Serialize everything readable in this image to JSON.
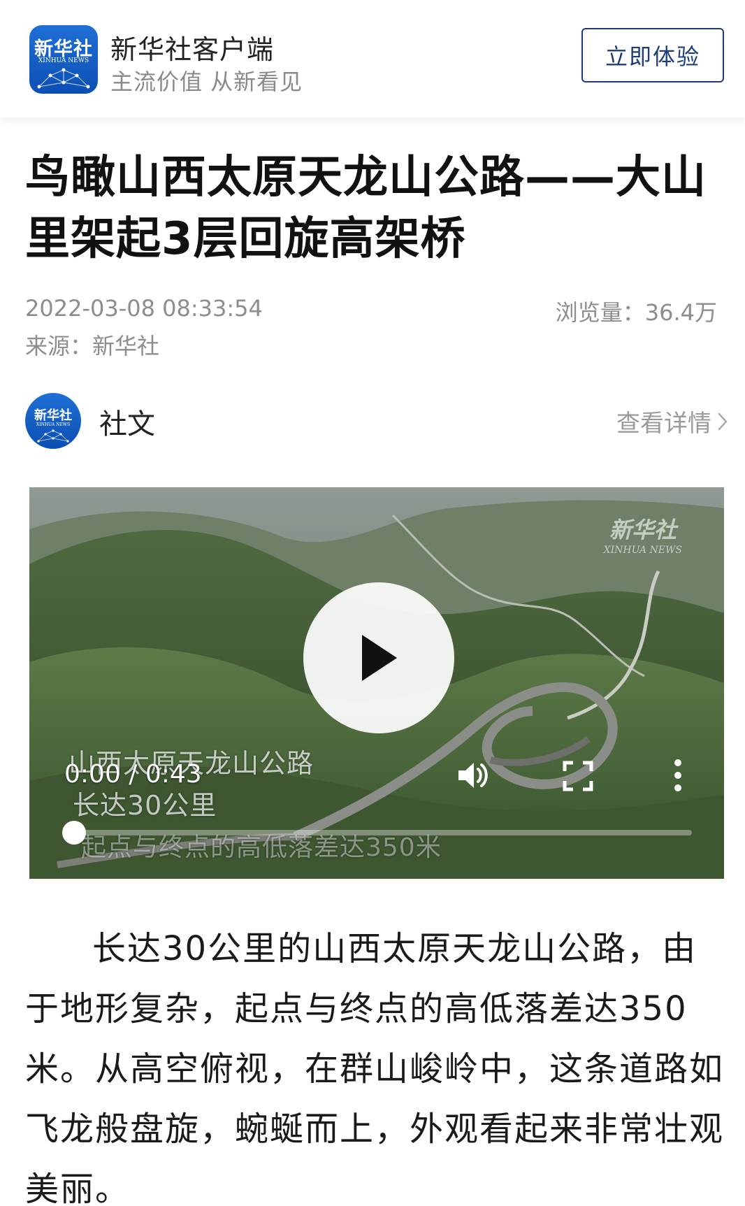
{
  "banner": {
    "logo_text": "新华社",
    "logo_sub": "XINHUA NEWS",
    "app_name": "新华社客户端",
    "slogan": "主流价值 从新看见",
    "try_label": "立即体验"
  },
  "article": {
    "title": "鸟瞰山西太原天龙山公路——大山里架起3层回旋高架桥",
    "date": "2022-03-08 08:33:54",
    "views": "浏览量：36.4万",
    "source": "来源：新华社"
  },
  "author": {
    "avatar_text": "新华社",
    "avatar_sub": "XINHUA NEWS",
    "name": "社文",
    "details_label": "查看详情"
  },
  "video": {
    "watermark_cn": "新华社",
    "watermark_en": "XINHUA NEWS",
    "captions": [
      "山西太原天龙山公路",
      "长达30公里",
      "起点与终点的高低落差达350米"
    ],
    "time": "0:00 / 0:43",
    "progress": 0.0,
    "icons": {
      "play": "play-icon",
      "volume": "volume-icon",
      "fullscreen": "fullscreen-icon",
      "more": "more-vertical-icon"
    }
  },
  "body": {
    "paragraph": "长达30公里的山西太原天龙山公路，由于地形复杂，起点与终点的高低落差达350米。从高空俯视，在群山峻岭中，这条道路如飞龙般盘旋，蜿蜒而上，外观看起来非常壮观美丽。"
  },
  "colors": {
    "brand_blue": "#0b4fb3",
    "button_navy": "#1d3d7a",
    "meta_gray": "#8d8d8d"
  }
}
